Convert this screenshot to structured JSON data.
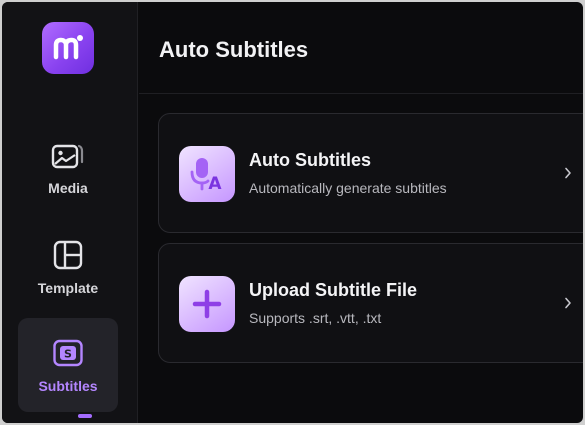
{
  "app": {
    "logo_icon": "m-logo-icon",
    "accent": "#a46cff"
  },
  "sidebar": {
    "items": [
      {
        "label": "Media",
        "icon": "image-gallery-icon",
        "active": false
      },
      {
        "label": "Template",
        "icon": "layout-grid-icon",
        "active": false
      },
      {
        "label": "Subtitles",
        "icon": "subtitle-s-icon",
        "active": true
      }
    ]
  },
  "header": {
    "title": "Auto Subtitles"
  },
  "cards": [
    {
      "title": "Auto Subtitles",
      "subtitle": "Automatically generate subtitles",
      "icon": "microphone-a-icon"
    },
    {
      "title": "Upload Subtitle File",
      "subtitle": "Supports .srt, .vtt, .txt",
      "icon": "plus-icon"
    }
  ]
}
